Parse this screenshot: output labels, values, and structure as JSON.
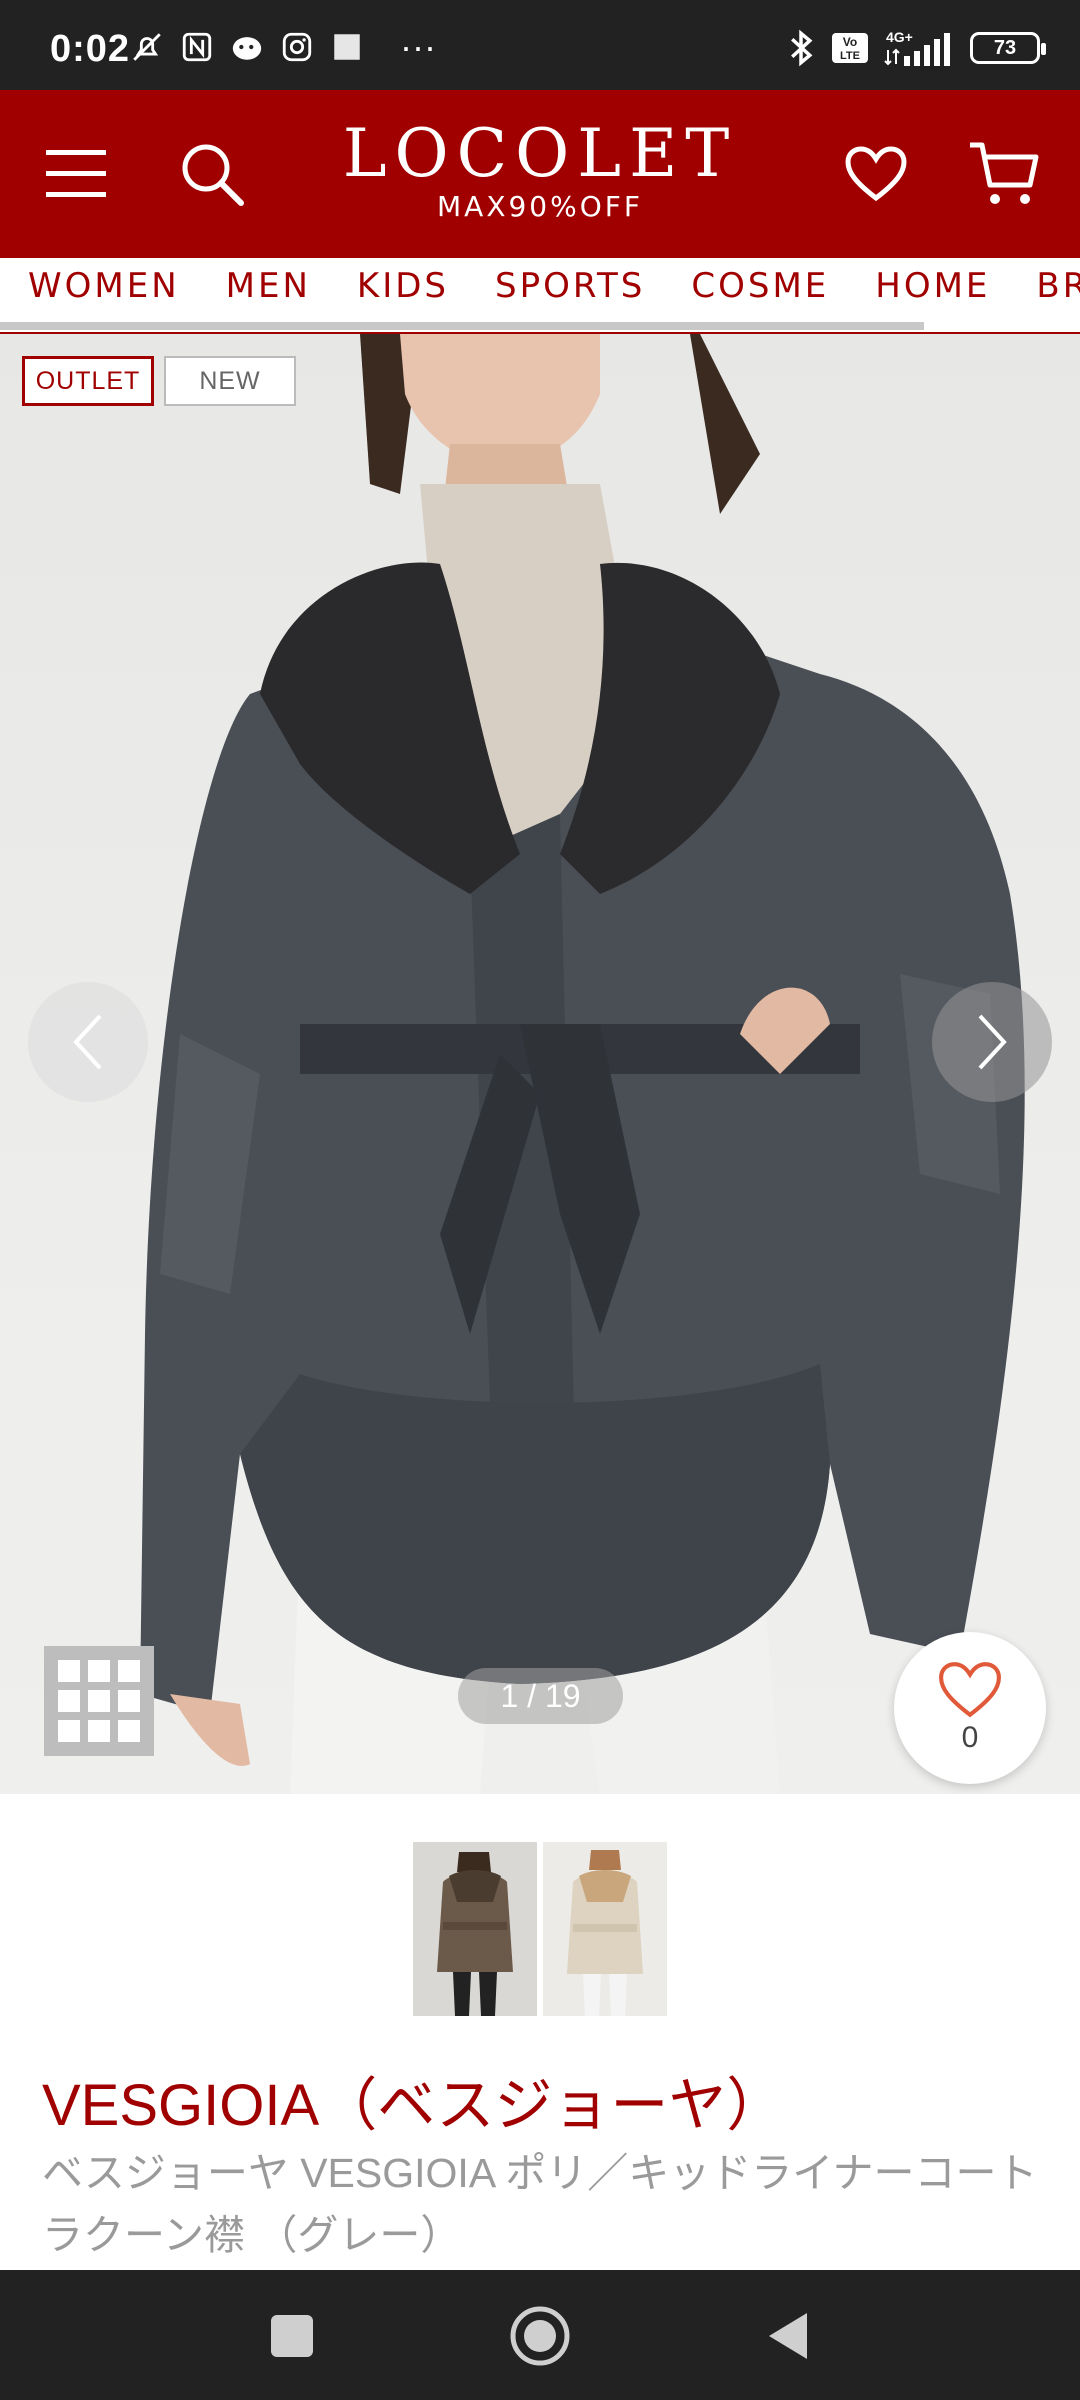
{
  "status_bar": {
    "time": "0:02",
    "overflow": "···",
    "battery": "73",
    "network": "4G+",
    "volte": "Vo LTE",
    "icons_left": [
      "mute-bell-icon",
      "nfc-icon",
      "app-notification-icon",
      "instagram-icon",
      "square-notification-icon"
    ],
    "icons_right": [
      "bluetooth-icon",
      "volte-icon",
      "signal-icon",
      "battery-icon"
    ]
  },
  "header": {
    "logo_name": "LOCOLET",
    "logo_sub": "MAX90%OFF",
    "bg_color": "#a00000"
  },
  "categories": [
    "WOMEN",
    "MEN",
    "KIDS",
    "SPORTS",
    "COSME",
    "HOME",
    "BRA"
  ],
  "carousel": {
    "tags": {
      "outlet": "OUTLET",
      "new": "NEW"
    },
    "counter": "1 / 19",
    "favorite_count": "0"
  },
  "product": {
    "brand": "VESGIOIA（ベスジョーヤ）",
    "name": "ベスジョーヤ VESGIOIA ポリ／キッドライナーコート ラクーン襟 （グレー）"
  }
}
